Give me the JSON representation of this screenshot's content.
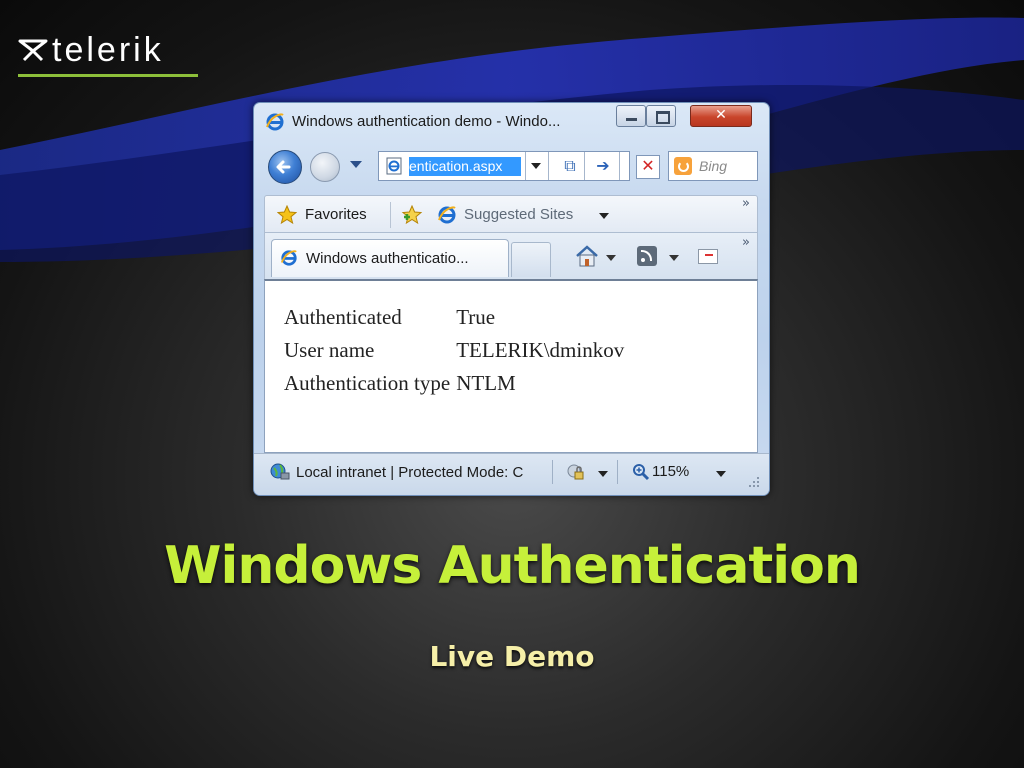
{
  "brand": {
    "logo_text": "telerik",
    "accent_color": "#8dbf3a"
  },
  "browser": {
    "title": "Windows authentication demo - Windo...",
    "address": "entication.aspx",
    "search_provider": "Bing",
    "favorites_label": "Favorites",
    "suggested_sites_label": "Suggested Sites",
    "tab_title": "Windows authenticatio...",
    "page": {
      "rows": [
        {
          "label": "Authenticated",
          "value": "True"
        },
        {
          "label": "User name",
          "value": "TELERIK\\dminkov"
        },
        {
          "label": "Authentication type",
          "value": "NTLM"
        }
      ]
    },
    "status": {
      "zone": "Local intranet | Protected Mode: C",
      "zoom": "115%"
    }
  },
  "slide": {
    "title": "Windows Authentication",
    "subtitle": "Live Demo",
    "title_color": "#c6f03a",
    "subtitle_color": "#f6efa8"
  }
}
